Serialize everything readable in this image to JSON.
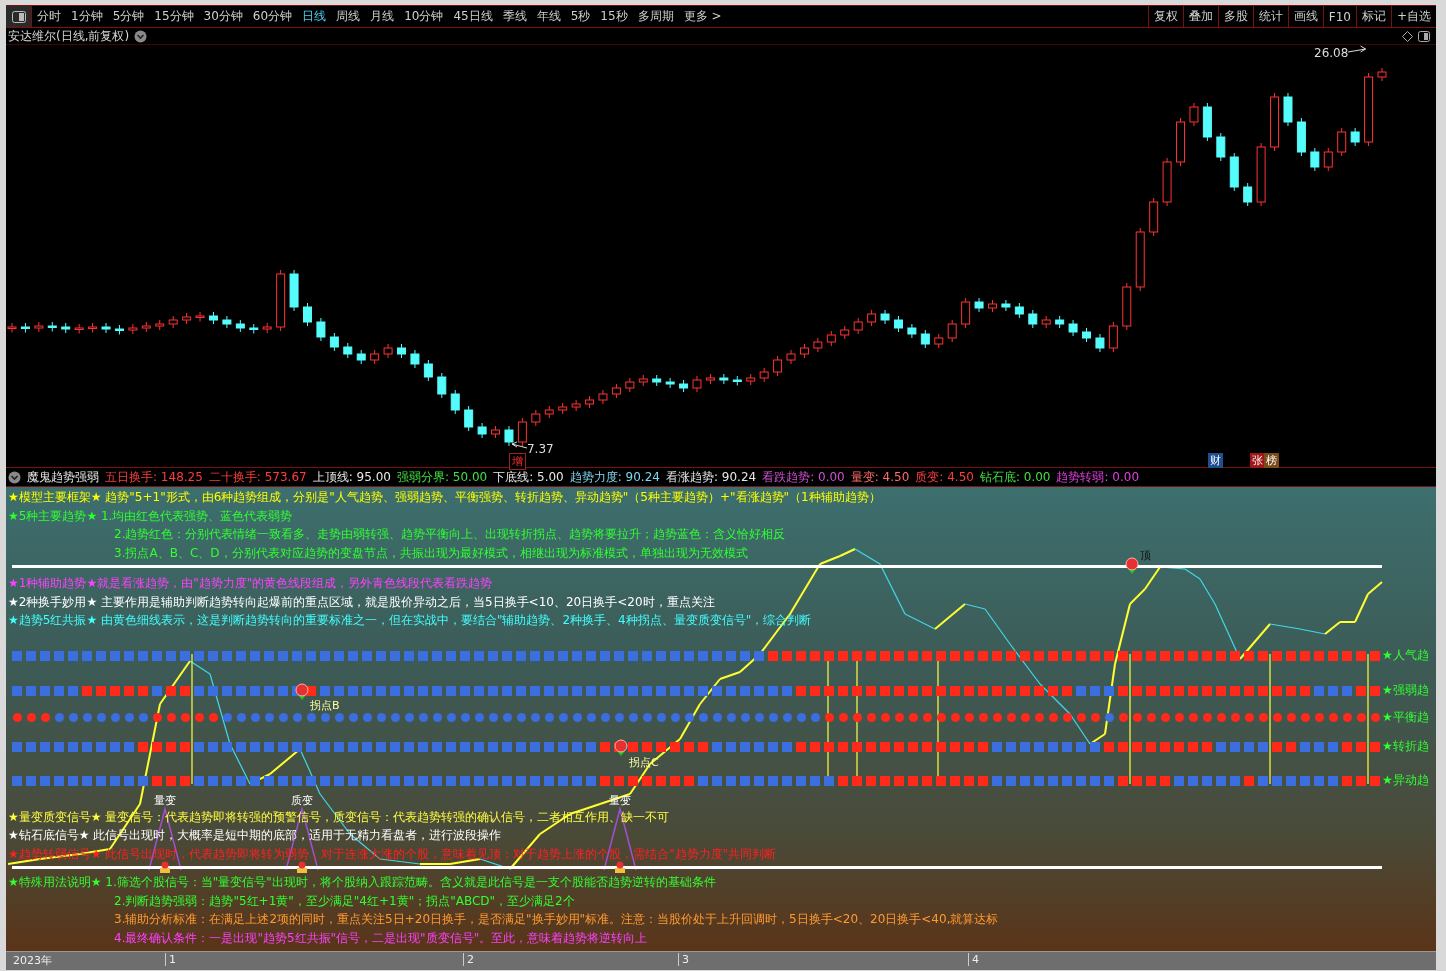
{
  "toolbar": {
    "periods": [
      {
        "label": "分时",
        "selected": false
      },
      {
        "label": "1分钟",
        "selected": false
      },
      {
        "label": "5分钟",
        "selected": false
      },
      {
        "label": "15分钟",
        "selected": false
      },
      {
        "label": "30分钟",
        "selected": false
      },
      {
        "label": "60分钟",
        "selected": false
      },
      {
        "label": "日线",
        "selected": true
      },
      {
        "label": "周线",
        "selected": false
      },
      {
        "label": "月线",
        "selected": false
      },
      {
        "label": "10分钟",
        "selected": false
      },
      {
        "label": "45日线",
        "selected": false
      },
      {
        "label": "季线",
        "selected": false
      },
      {
        "label": "年线",
        "selected": false
      },
      {
        "label": "5秒",
        "selected": false
      },
      {
        "label": "15秒",
        "selected": false
      },
      {
        "label": "多周期",
        "selected": false
      },
      {
        "label": "更多 >",
        "selected": false
      }
    ],
    "tools": [
      "复权",
      "叠加",
      "多股",
      "统计",
      "画线",
      "F10",
      "标记",
      "+自选"
    ]
  },
  "chart_title": "安达维尔(日线,前复权)",
  "price_chart": {
    "high_label": "26.08",
    "low_label": "7.37",
    "event_tag": "增",
    "badges": [
      {
        "label": "财",
        "color": "#1f4f8f"
      },
      {
        "label": "张",
        "color": "#a01515"
      },
      {
        "label": "榜",
        "color": "#7a4a1a"
      }
    ]
  },
  "indicator": {
    "name": "魔鬼趋势强弱",
    "values": [
      {
        "label": "五日换手:",
        "value": "148.25",
        "color": "#ff3b3b"
      },
      {
        "label": "二十换手:",
        "value": "573.67",
        "color": "#ff3b3b"
      },
      {
        "label": "上顶线:",
        "value": "95.00",
        "color": "#e8e8e8"
      },
      {
        "label": "强弱分界:",
        "value": "50.00",
        "color": "#40e040"
      },
      {
        "label": "下底线:",
        "value": "5.00",
        "color": "#e8e8e8"
      },
      {
        "label": "趋势力度:",
        "value": "90.24",
        "color": "#7fd8f0"
      },
      {
        "label": "看涨趋势:",
        "value": "90.24",
        "color": "#e8e8e8"
      },
      {
        "label": "看跌趋势:",
        "value": "0.00",
        "color": "#d050d0"
      },
      {
        "label": "量变:",
        "value": "4.50",
        "color": "#ff6a6a"
      },
      {
        "label": "质变:",
        "value": "4.50",
        "color": "#ff3b3b"
      },
      {
        "label": "钻石底:",
        "value": "0.00",
        "color": "#40e040"
      },
      {
        "label": "趋势转弱:",
        "value": "0.00",
        "color": "#e040e0"
      }
    ],
    "notes_top": [
      {
        "kind": "lead",
        "color": "#ffff00",
        "text": "★模型主要框架★ 趋势\"5+1\"形式，由6种趋势组成，分别是\"人气趋势、强弱趋势、平衡强势、转折趋势、异动趋势\"（5种主要趋势）+\"看涨趋势\"（1种辅助趋势）"
      },
      {
        "kind": "lead",
        "color": "#30ff30",
        "text": "★5种主要趋势★ 1.均由红色代表强势、蓝色代表弱势"
      },
      {
        "kind": "sub",
        "color": "#30ff30",
        "text": "2.趋势红色：分别代表情绪一致看多、走势由弱转强、趋势平衡向上、出现转折拐点、趋势将要拉升；趋势蓝色：含义恰好相反"
      },
      {
        "kind": "sub",
        "color": "#30ff30",
        "text": "3.拐点A、B、C、D，分别代表对应趋势的变盘节点，共振出现为最好模式，相继出现为标准模式，单独出现为无效模式"
      }
    ],
    "notes_middle": [
      {
        "kind": "lead",
        "color": "#ff40ff",
        "text": "★1种辅助趋势★就是看涨趋势，由\"趋势力度\"的黄色线段组成，另外青色线段代表看跌趋势"
      },
      {
        "kind": "lead",
        "color": "#ffffff",
        "text": "★2种换手妙用★ 主要作用是辅助判断趋势转向起爆前的重点区域，就是股价异动之后，当5日换手<10、20日换手<20时，重点关注"
      },
      {
        "kind": "lead",
        "color": "#40ffff",
        "text": "★趋势5红共振★ 由黄色细线表示，这是判断趋势转向的重要标准之一，但在实战中，要结合\"辅助趋势、2种换手、4种拐点、量变质变信号\"，综合判断"
      }
    ],
    "trend_rows": [
      {
        "label": "★人气趋",
        "kind": "square",
        "strong": [
          false,
          false,
          false,
          false,
          false,
          false,
          false,
          false,
          false,
          false,
          false,
          false,
          false,
          false,
          false,
          false,
          false,
          false,
          false,
          false,
          false,
          false,
          false,
          false,
          false,
          false,
          false,
          false,
          false,
          false,
          false,
          false,
          false,
          false,
          false,
          false,
          false,
          false,
          false,
          false,
          false,
          false,
          false,
          false,
          false,
          false,
          false,
          false,
          false,
          false,
          false,
          false,
          false,
          false,
          true,
          true,
          true,
          true,
          true,
          true,
          true,
          true,
          true,
          true,
          true,
          true,
          true,
          true,
          true,
          true,
          true,
          true,
          true,
          true,
          true,
          true,
          true,
          true,
          true,
          true,
          true,
          true,
          true,
          true,
          true,
          true,
          true,
          true,
          true,
          true,
          true,
          true,
          true,
          true,
          true,
          true,
          true,
          true
        ]
      },
      {
        "label": "★强弱趋",
        "kind": "square",
        "strong": [
          false,
          false,
          false,
          false,
          false,
          true,
          true,
          true,
          true,
          true,
          false,
          true,
          true,
          false,
          false,
          false,
          false,
          false,
          false,
          false,
          false,
          true,
          false,
          false,
          false,
          false,
          false,
          false,
          false,
          false,
          false,
          false,
          false,
          false,
          false,
          false,
          false,
          false,
          false,
          false,
          false,
          false,
          false,
          false,
          false,
          false,
          false,
          false,
          false,
          false,
          false,
          false,
          false,
          false,
          false,
          false,
          true,
          true,
          true,
          true,
          true,
          true,
          true,
          true,
          true,
          true,
          true,
          true,
          true,
          true,
          true,
          true,
          true,
          true,
          true,
          true,
          false,
          false,
          false,
          true,
          true,
          true,
          true,
          true,
          true,
          true,
          true,
          true,
          true,
          true,
          true,
          true,
          true,
          false,
          false,
          false,
          true,
          true
        ]
      },
      {
        "label": "★平衡趋",
        "kind": "dot",
        "strong": [
          true,
          true,
          true,
          false,
          false,
          false,
          false,
          false,
          false,
          false,
          true,
          true,
          true,
          true,
          true,
          false,
          false,
          false,
          false,
          false,
          false,
          false,
          false,
          false,
          false,
          false,
          false,
          false,
          false,
          false,
          false,
          false,
          false,
          false,
          false,
          false,
          false,
          false,
          false,
          false,
          false,
          false,
          false,
          false,
          false,
          false,
          false,
          false,
          false,
          false,
          false,
          false,
          false,
          false,
          false,
          false,
          false,
          false,
          true,
          true,
          true,
          true,
          true,
          true,
          true,
          true,
          true,
          true,
          true,
          true,
          true,
          true,
          true,
          true,
          true,
          true,
          true,
          true,
          false,
          true,
          true,
          true,
          true,
          true,
          true,
          true,
          true,
          true,
          true,
          true,
          true,
          true,
          true,
          true,
          true,
          true,
          true,
          true
        ]
      },
      {
        "label": "★转折趋",
        "kind": "square",
        "strong": [
          false,
          false,
          false,
          false,
          false,
          false,
          false,
          false,
          false,
          true,
          true,
          true,
          true,
          false,
          false,
          false,
          false,
          false,
          false,
          false,
          false,
          false,
          false,
          false,
          false,
          false,
          false,
          false,
          false,
          false,
          false,
          false,
          false,
          false,
          false,
          false,
          false,
          false,
          false,
          false,
          false,
          false,
          true,
          true,
          true,
          true,
          true,
          true,
          true,
          true,
          false,
          false,
          false,
          false,
          false,
          false,
          true,
          true,
          true,
          true,
          true,
          true,
          true,
          true,
          true,
          true,
          true,
          true,
          true,
          true,
          false,
          false,
          false,
          false,
          false,
          false,
          false,
          false,
          true,
          true,
          true,
          true,
          true,
          true,
          true,
          true,
          false,
          false,
          false,
          false,
          true,
          true,
          false,
          false,
          false,
          true,
          true,
          true
        ]
      },
      {
        "label": "★异动趋",
        "kind": "square",
        "strong": [
          false,
          false,
          false,
          false,
          false,
          false,
          false,
          false,
          false,
          false,
          true,
          true,
          true,
          false,
          false,
          false,
          false,
          false,
          false,
          false,
          false,
          false,
          false,
          false,
          false,
          false,
          false,
          false,
          false,
          false,
          false,
          false,
          false,
          false,
          false,
          false,
          false,
          false,
          false,
          false,
          false,
          false,
          true,
          true,
          true,
          true,
          true,
          true,
          true,
          false,
          false,
          false,
          false,
          false,
          false,
          false,
          false,
          false,
          false,
          true,
          true,
          true,
          true,
          true,
          true,
          true,
          true,
          true,
          true,
          true,
          false,
          false,
          false,
          false,
          false,
          false,
          false,
          false,
          false,
          true,
          true,
          true,
          true,
          false,
          false,
          false,
          false,
          false,
          true,
          false,
          false,
          false,
          false,
          false,
          false,
          true,
          true,
          true
        ]
      }
    ],
    "markers": [
      {
        "label": "顶"
      },
      {
        "label": "拐点B"
      },
      {
        "label": "拐点C"
      }
    ],
    "signals": [
      {
        "label": "量变"
      },
      {
        "label": "质变"
      },
      {
        "label": "量变"
      }
    ],
    "notes_bottom": [
      {
        "kind": "lead",
        "color": "#ffff40",
        "text": "★量变质变信号★ 量变信号：代表趋势即将转强的预警信号，质变信号：代表趋势转强的确认信号，二者相互作用、缺一不可"
      },
      {
        "kind": "lead",
        "color": "#ffffff",
        "text": "★钻石底信号★ 此信号出现时，大概率是短中期的底部，适用于无精力看盘者，进行波段操作"
      },
      {
        "kind": "lead",
        "color": "#ff2020",
        "text": "★趋势转弱信号★ 此信号出现时，代表趋势即将转为弱势，对于连涨大涨的个股，意味着见顶；对于趋势上涨的个股，需结合\"趋势力度\"共同判断"
      }
    ],
    "notes_last": [
      {
        "kind": "lead",
        "color": "#30ff30",
        "text": "★特殊用法说明★ 1.筛选个股信号：当\"量变信号\"出现时，将个股纳入跟踪范畴。含义就是此信号是一支个股能否趋势逆转的基础条件"
      },
      {
        "kind": "sub",
        "color": "#30ff30",
        "text": "2.判断趋势强弱：趋势\"5红+1黄\"，至少满足\"4红+1黄\"；拐点\"ABCD\"，至少满足2个"
      },
      {
        "kind": "sub",
        "color": "#ff9a30",
        "text": "3.辅助分析标准：在满足上述2项的同时，重点关注5日+20日换手，是否满足\"换手妙用\"标准。注意：当股价处于上升回调时，5日换手<20、20日换手<40,就算达标"
      },
      {
        "kind": "sub",
        "color": "#ff40ff",
        "text": "4.最终确认条件：一是出现\"趋势5红共振\"信号，二是出现\"质变信号\"。至此，意味着趋势将逆转向上"
      }
    ]
  },
  "time_axis": [
    "2023年",
    "1",
    "2",
    "3",
    "4"
  ]
}
